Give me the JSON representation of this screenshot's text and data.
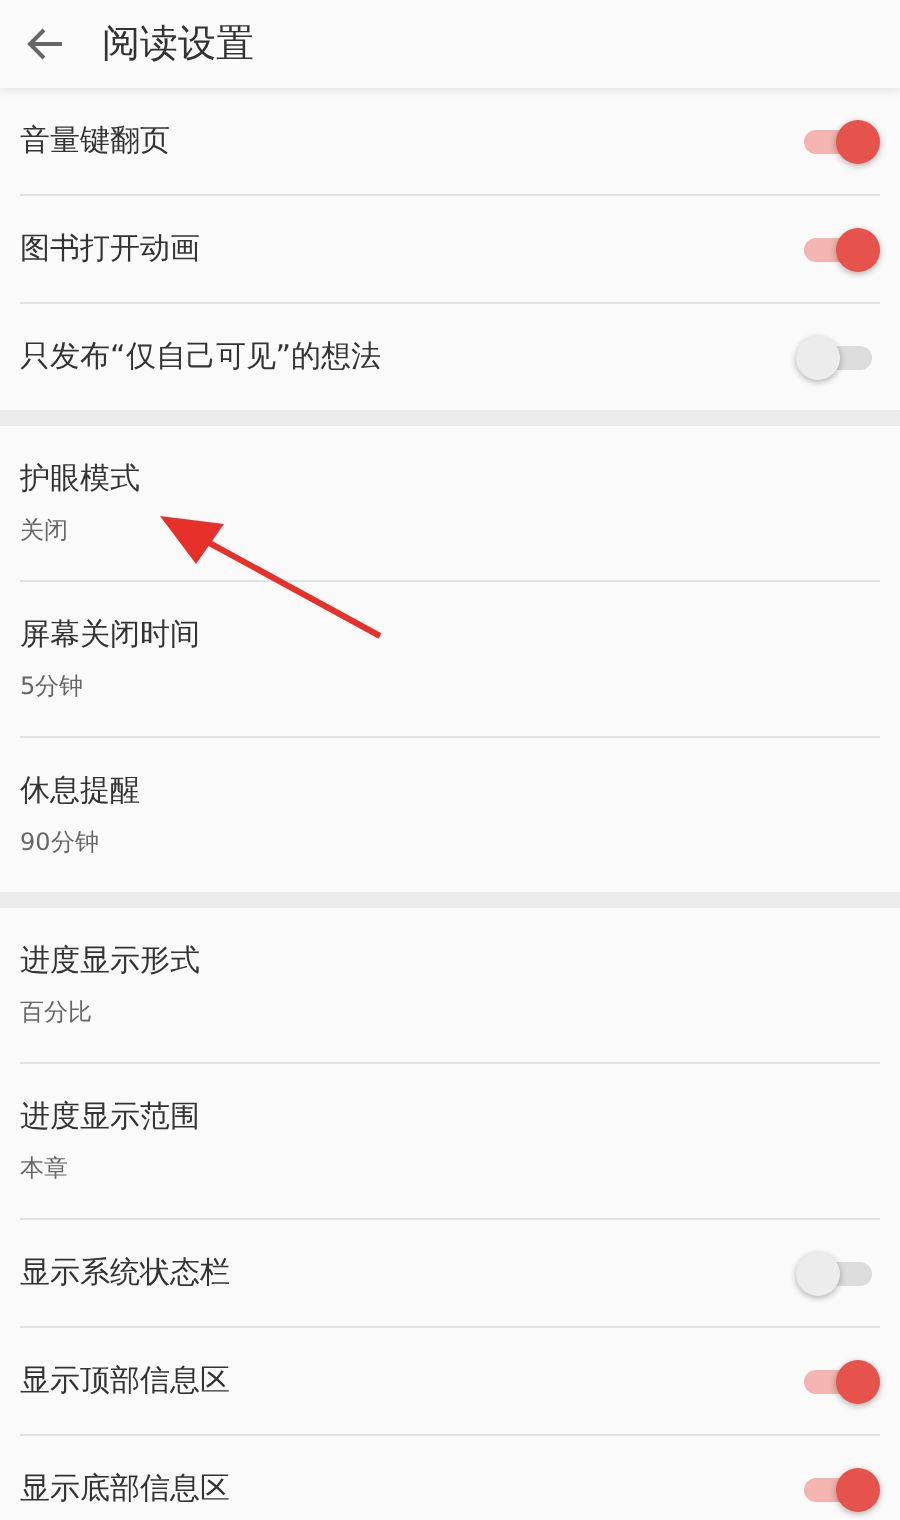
{
  "header": {
    "title": "阅读设置"
  },
  "sections": [
    {
      "items": [
        {
          "kind": "toggle",
          "label": "音量键翻页",
          "on": true
        },
        {
          "kind": "toggle",
          "label": "图书打开动画",
          "on": true
        },
        {
          "kind": "toggle",
          "label": "只发布“仅自己可见”的想法",
          "on": false
        }
      ]
    },
    {
      "items": [
        {
          "kind": "value",
          "label": "护眼模式",
          "value": "关闭"
        },
        {
          "kind": "value",
          "label": "屏幕关闭时间",
          "value": "5分钟"
        },
        {
          "kind": "value",
          "label": "休息提醒",
          "value": "90分钟"
        }
      ]
    },
    {
      "items": [
        {
          "kind": "value",
          "label": "进度显示形式",
          "value": "百分比"
        },
        {
          "kind": "value",
          "label": "进度显示范围",
          "value": "本章"
        },
        {
          "kind": "toggle",
          "label": "显示系统状态栏",
          "on": false
        },
        {
          "kind": "toggle",
          "label": "显示顶部信息区",
          "on": true
        },
        {
          "kind": "toggle",
          "label": "显示底部信息区",
          "on": true
        }
      ]
    }
  ]
}
